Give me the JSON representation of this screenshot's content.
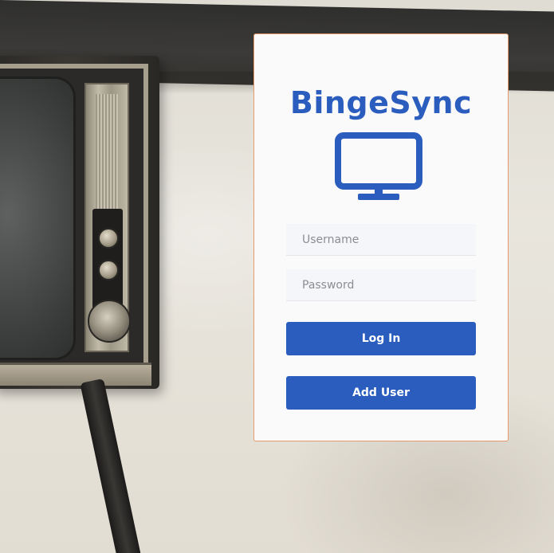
{
  "brand": {
    "title": "BingeSync",
    "logo_icon": "monitor-icon",
    "accent_color": "#2b5dbf"
  },
  "form": {
    "username_placeholder": "Username",
    "password_placeholder": "Password",
    "login_label": "Log In",
    "add_user_label": "Add User"
  },
  "colors": {
    "card_border": "#e49a6c",
    "button": "#2b5dbf",
    "card_background": "#fafafa"
  }
}
